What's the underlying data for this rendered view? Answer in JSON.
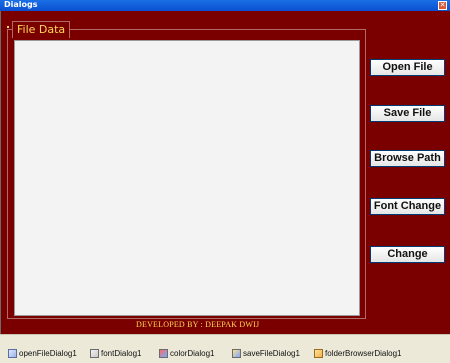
{
  "window": {
    "title": "Dialogs",
    "close_glyph": "✕"
  },
  "form": {
    "group_title": "File Data",
    "buttons": {
      "open_file": "Open File",
      "save_file": "Save File",
      "browse_path": "Browse Path",
      "font_change": "Font Change",
      "change": "Change"
    },
    "credit": "DEVELOPED BY : DEEPAK DWIJ"
  },
  "component_tray": {
    "items": [
      {
        "label": "openFileDialog1",
        "icon": "open-file-dialog-icon"
      },
      {
        "label": "fontDialog1",
        "icon": "font-dialog-icon"
      },
      {
        "label": "colorDialog1",
        "icon": "color-dialog-icon"
      },
      {
        "label": "saveFileDialog1",
        "icon": "save-file-dialog-icon"
      },
      {
        "label": "folderBrowserDialog1",
        "icon": "folder-browser-dialog-icon"
      }
    ]
  },
  "colors": {
    "form_background": "#7a0000",
    "title_bar": "#0b4fd0",
    "accent_text": "#ffd75a",
    "text_area": "#f3f3f3",
    "tray_background": "#ece9d8"
  }
}
